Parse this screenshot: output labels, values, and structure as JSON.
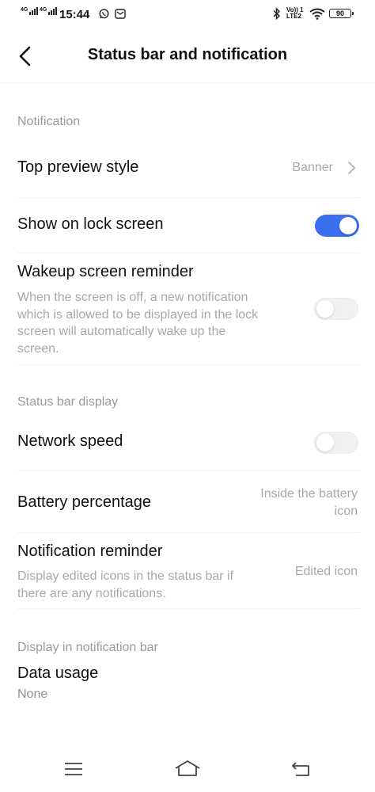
{
  "status_bar": {
    "net1": "4G",
    "net2": "4G",
    "time": "15:44",
    "lte_top": "Vo)) 1",
    "lte_bottom": "LTE2",
    "battery": "90"
  },
  "header": {
    "title": "Status bar and notification"
  },
  "notification": {
    "section_label": "Notification",
    "top_preview": {
      "label": "Top preview style",
      "value": "Banner"
    },
    "lock_screen": {
      "label": "Show on lock screen",
      "enabled": true
    },
    "wakeup": {
      "label": "Wakeup screen reminder",
      "desc": [
        "When the screen is off, a new notification",
        "which is allowed to be displayed in the lock",
        "screen will automatically wake up the",
        "screen."
      ],
      "enabled": false
    }
  },
  "status_bar_display": {
    "section_label": "Status bar display",
    "network_speed": {
      "label": "Network speed",
      "enabled": false
    },
    "battery_percentage": {
      "label": "Battery percentage",
      "value": [
        "Inside the battery",
        "icon"
      ]
    },
    "notification_reminder": {
      "label": "Notification reminder",
      "desc": [
        "Display edited icons in the status bar if",
        "there are any notifications."
      ],
      "value": "Edited icon"
    }
  },
  "notification_bar": {
    "section_label": "Display in notification bar",
    "data_usage": {
      "label": "Data usage",
      "value": "None"
    }
  },
  "colors": {
    "accent": "#3a6ff0",
    "secondary_text": "#a8a8a8"
  }
}
